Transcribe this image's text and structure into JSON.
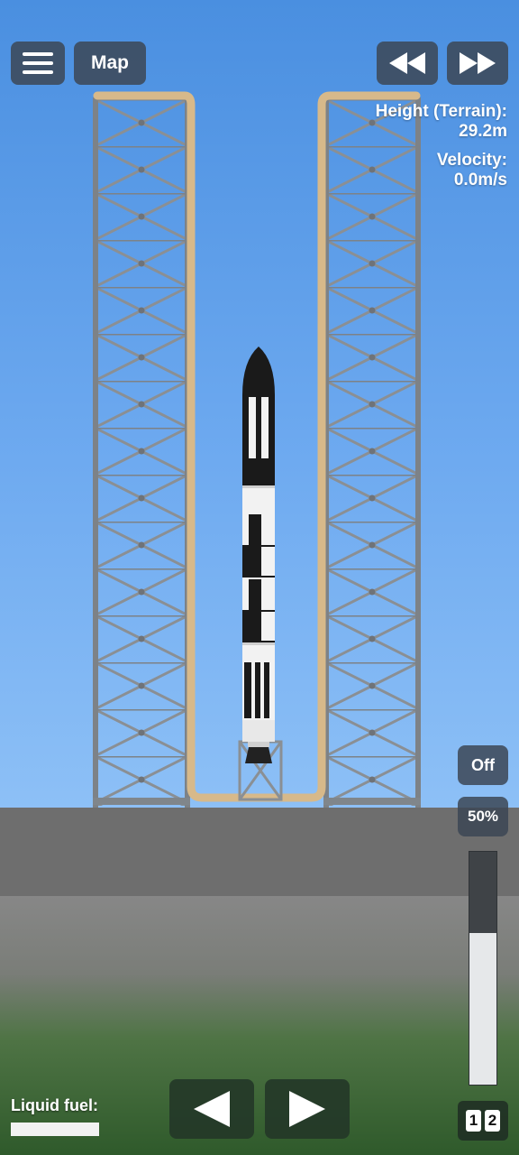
{
  "top_bar": {
    "menu_icon": "hamburger-menu-icon",
    "map_label": "Map",
    "rewind_icon": "rewind-icon",
    "fast_forward_icon": "fast-forward-icon"
  },
  "telemetry": {
    "height_label": "Height (Terrain):",
    "height_value": "29.2m",
    "velocity_label": "Velocity:",
    "velocity_value": "0.0m/s"
  },
  "controls": {
    "toggle_label": "Off",
    "throttle_label": "50%",
    "throttle_fraction": 0.65,
    "left_icon": "arrow-left-icon",
    "right_icon": "arrow-right-icon"
  },
  "fuel": {
    "label": "Liquid fuel:",
    "fraction": 1.0
  },
  "stages": [
    "1",
    "2"
  ],
  "colors": {
    "sky_top": "#4a8fe0",
    "sky_bottom": "#a7d0f8",
    "ground": "#707070",
    "grass": "#3a6a32",
    "tower_steel": "#8a8f94",
    "tower_pipe": "#d7b98a",
    "rocket_black": "#1a1a1a",
    "rocket_white": "#f2f2f2"
  }
}
